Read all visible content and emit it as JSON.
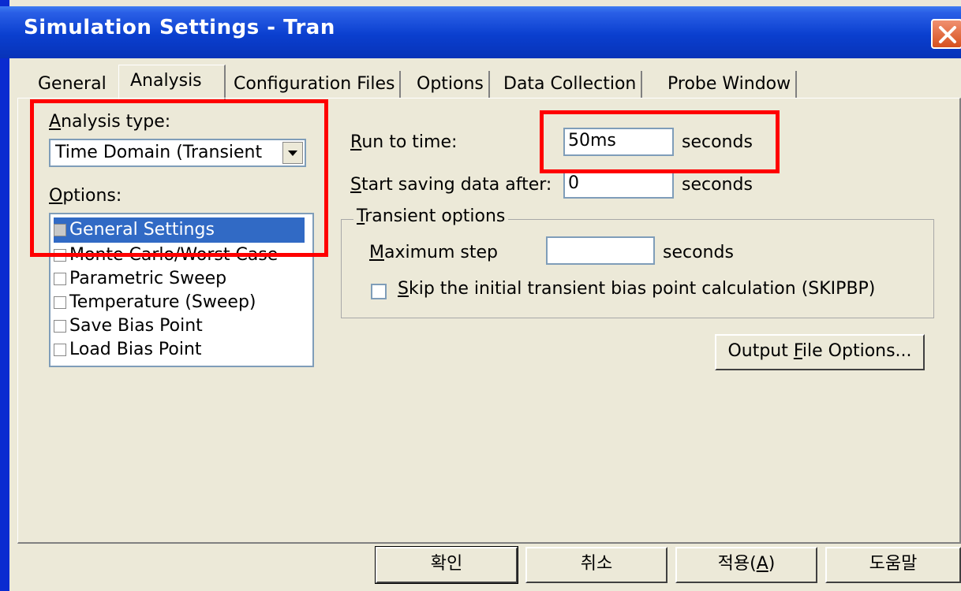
{
  "window": {
    "title": "Simulation Settings - Tran"
  },
  "tabs": [
    "General",
    "Analysis",
    "Configuration Files",
    "Options",
    "Data Collection",
    "Probe Window"
  ],
  "analysis_type": {
    "label_first": "A",
    "label_rest": "nalysis type:",
    "value": "Time Domain (Transient"
  },
  "options": {
    "label_first": "O",
    "label_rest": "ptions:",
    "items": [
      {
        "label": "General Settings",
        "checked": true,
        "selected": true
      },
      {
        "label": "Monte Carlo/Worst Case",
        "checked": false
      },
      {
        "label": "Parametric Sweep",
        "checked": false
      },
      {
        "label": "Temperature (Sweep)",
        "checked": false
      },
      {
        "label": "Save Bias Point",
        "checked": false
      },
      {
        "label": "Load Bias Point",
        "checked": false
      }
    ]
  },
  "run_to_time": {
    "label_first": "R",
    "label_rest": "un to time:",
    "value": "50ms",
    "unit": "seconds"
  },
  "start_saving": {
    "label_first": "S",
    "label_rest": "tart saving data after:",
    "value": "0",
    "unit": "seconds"
  },
  "transient_options": {
    "title_first": "T",
    "title_rest": "ransient options",
    "max_step_first": "M",
    "max_step_rest": "aximum step",
    "max_step_value": "",
    "max_step_unit": "seconds",
    "skip_first": "S",
    "skip_rest": "kip the initial transient bias point calculation  (SKIPBP)"
  },
  "output_file": {
    "label_before": "Output ",
    "label_u": "F",
    "label_after": "ile Options..."
  },
  "buttons": {
    "ok": "확인",
    "cancel": "취소",
    "apply_before": "적용(",
    "apply_u": "A",
    "apply_after": ")",
    "help": "도움말"
  },
  "colors": {
    "highlight": "#316ac5",
    "annotation": "#ff0000",
    "titlebar": "#0a3fcf"
  }
}
